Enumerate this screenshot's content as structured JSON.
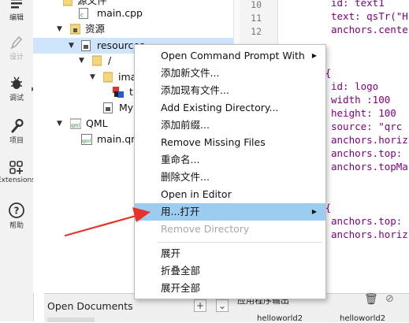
{
  "modebar": {
    "items": [
      {
        "label": "编辑",
        "icon": "edit-icon"
      },
      {
        "label": "设计",
        "icon": "pen-icon"
      },
      {
        "label": "调试",
        "icon": "bug-icon"
      },
      {
        "label": "项目",
        "icon": "wrench-icon"
      },
      {
        "label": "Extensions",
        "icon": "extensions-icon"
      },
      {
        "label": "帮助",
        "icon": "help-icon"
      }
    ]
  },
  "tree": {
    "rows": [
      {
        "label": "源文件",
        "icon": "folder-icon"
      },
      {
        "label": "main.cpp",
        "icon": "cpp-file-icon"
      },
      {
        "label": "资源",
        "icon": "lock-folder-icon"
      },
      {
        "label": "resources",
        "icon": "qrc-file-icon"
      },
      {
        "label": "/",
        "icon": "folder-icon"
      },
      {
        "label": "ima",
        "icon": "folder-icon"
      },
      {
        "label": "t",
        "icon": "image-file-icon"
      },
      {
        "label": "My",
        "icon": "lock-file-icon"
      },
      {
        "label": "QML",
        "icon": "qml-folder-icon"
      },
      {
        "label": "main.qml",
        "icon": "qml-file-icon"
      }
    ]
  },
  "editor": {
    "line_numbers": [
      "10",
      "11",
      "12"
    ],
    "code": [
      "id: text1",
      "text: qsTr(\"H",
      "anchors.cente",
      "ge {",
      "id: logo",
      "width :100",
      "height: 100",
      "source: \"qrc",
      "anchors.horiz",
      "anchors.top: ",
      "anchors.topMa",
      "ext{",
      "anchors.top: ",
      "anchors.horiz"
    ]
  },
  "context_menu": {
    "items": [
      "Open Command Prompt With",
      "添加新文件...",
      "添加现有文件...",
      "Add Existing Directory...",
      "添加前缀...",
      "Remove Missing Files",
      "重命名...",
      "删除文件...",
      "Open in Editor",
      "用...打开",
      "Remove Directory",
      "展开",
      "折叠全部",
      "展开全部"
    ],
    "highlighted": "用...打开",
    "disabled": "Remove Directory"
  },
  "bottom": {
    "open_documents": "Open Documents",
    "output_tab": "应用程序输出",
    "doc_tab_1": "helloworld2",
    "doc_tab_2": "helloworld2"
  },
  "colors": {
    "highlight": "#9cccef",
    "selection": "#cfe5fb",
    "arrow": "#e8322a"
  }
}
